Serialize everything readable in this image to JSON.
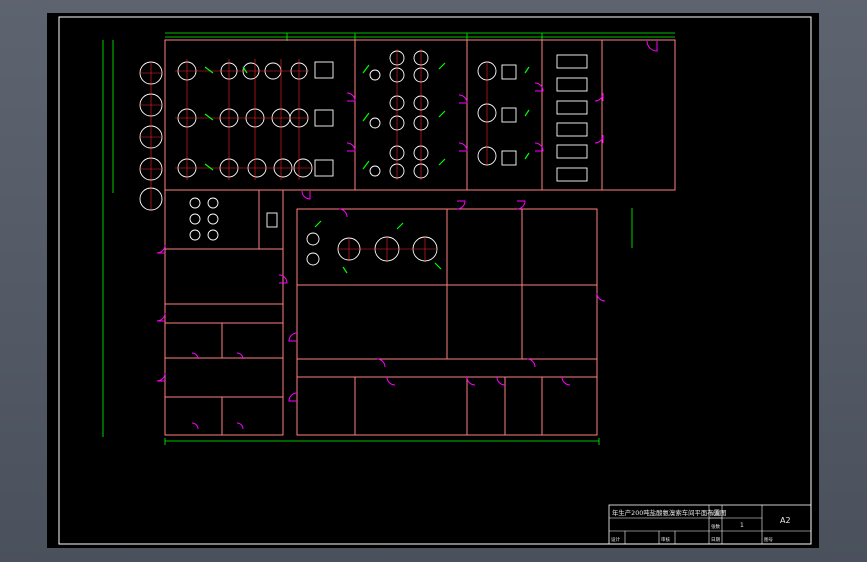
{
  "app": {
    "window_title": "",
    "viewport_background": "#565d68",
    "sheet_background": "#000000"
  },
  "colors": {
    "wall": "#ff8080",
    "dimension": "#00ff00",
    "equipment": "#ffffff",
    "axis_red": "#ff2020",
    "door": "#ff00ff",
    "pipe_green": "#00ff00",
    "frame": "#ffffff",
    "label": "#d0d0d0"
  },
  "title_block": {
    "drawing_title": "年生产200吨盐酸氨溴索车间平面布置图",
    "scale_label": "比例",
    "sheet_label": "张数",
    "sheet_value": "1",
    "size_value": "A2",
    "drawn_label": "设计",
    "checked_label": "审核",
    "date_label": "日期",
    "no_label": "图号"
  }
}
